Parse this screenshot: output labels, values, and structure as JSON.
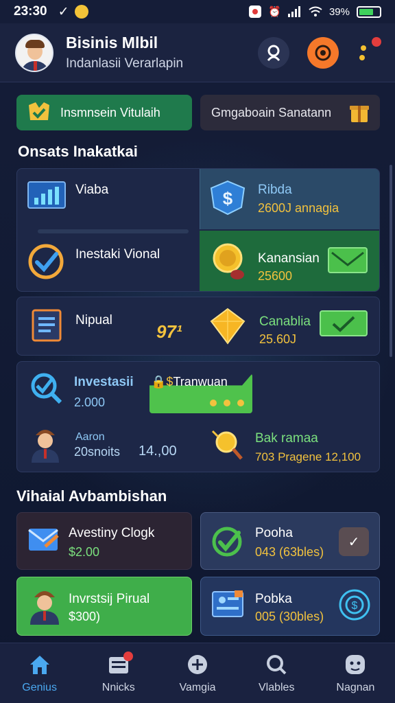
{
  "status": {
    "time": "23:30",
    "battery": "39%",
    "battery_level": 0.7
  },
  "header": {
    "title": "Bisinis Mlbil",
    "subtitle": "Indanlasii Verarlapin"
  },
  "actions": {
    "virtual_label": "Insmnsein Vitulaih",
    "sgm_label": "Gmgaboain Sanatann"
  },
  "section1": {
    "title": "Onsats Inakatkai",
    "card_viaba": {
      "title": "Viaba"
    },
    "card_ribda": {
      "title": "Ribda",
      "sub": "2600J annagia"
    },
    "card_invest_vional": {
      "title": "Inestaki Vional"
    },
    "card_kanansian": {
      "title": "Kanansian",
      "sub": "25600"
    },
    "card_nipual": {
      "title": "Nipual",
      "value": "97¹"
    },
    "card_canablia": {
      "title": "Canablia",
      "sub": "25.60J"
    },
    "card_investasii": {
      "title": "Investasii",
      "sub": "2.000",
      "tag": "Tranwuan"
    },
    "card_aaron": {
      "title": "Aaron",
      "sub": "20snoits",
      "value": "14.,00"
    },
    "card_bak": {
      "title": "Bak ramaa",
      "sub": "703 Pragene 12,100"
    }
  },
  "section2": {
    "title": "Vihaial Avbambishan",
    "item1": {
      "title": "Avestiny Clogk",
      "sub": "$2.00"
    },
    "item2": {
      "title": "Pooha",
      "sub": "043 (63bles)"
    },
    "item3": {
      "title": "Invrstsij Pirual",
      "sub": "$300)"
    },
    "item4": {
      "title": "Pobka",
      "sub": "005 (30bles)"
    }
  },
  "nav": {
    "items": [
      {
        "label": "Genius"
      },
      {
        "label": "Nnicks"
      },
      {
        "label": "Vamgia"
      },
      {
        "label": "Vlables"
      },
      {
        "label": "Nagnan"
      }
    ]
  },
  "colors": {
    "accent_green": "#1f7a4c",
    "accent_orange": "#f5782a",
    "accent_blue": "#4aa8f0",
    "gold": "#f2c23e"
  }
}
